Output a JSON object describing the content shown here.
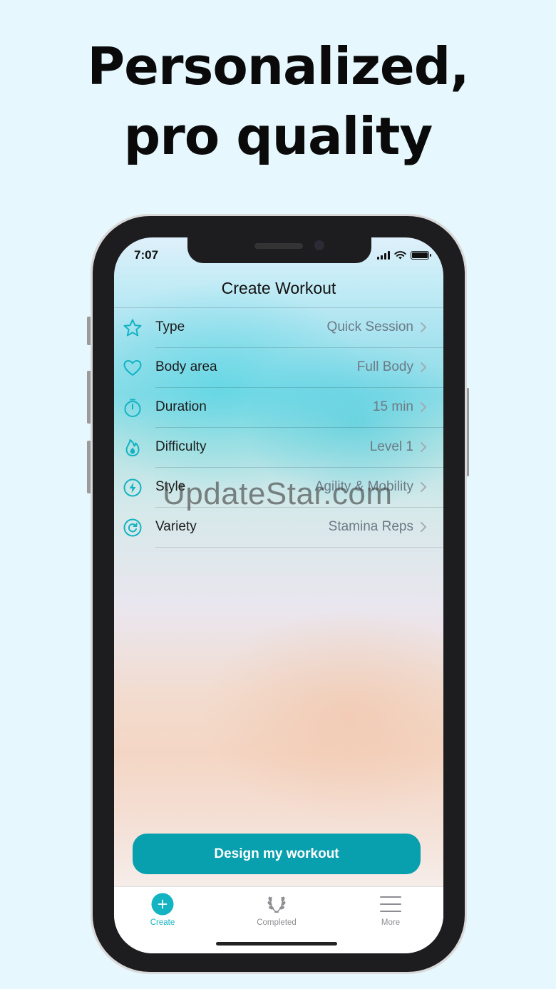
{
  "headline": {
    "line1": "Personalized,",
    "line2": "pro quality"
  },
  "watermark": "UpdateStar.com",
  "status_bar": {
    "time": "7:07"
  },
  "nav": {
    "title": "Create Workout"
  },
  "settings": [
    {
      "label": "Type",
      "value": "Quick Session",
      "icon": "star-icon"
    },
    {
      "label": "Body area",
      "value": "Full Body",
      "icon": "heart-icon"
    },
    {
      "label": "Duration",
      "value": "15 min",
      "icon": "stopwatch-icon"
    },
    {
      "label": "Difficulty",
      "value": "Level 1",
      "icon": "flame-icon"
    },
    {
      "label": "Style",
      "value": "Agility & Mobility",
      "icon": "bolt-icon"
    },
    {
      "label": "Variety",
      "value": "Stamina Reps",
      "icon": "refresh-icon"
    }
  ],
  "design_button": {
    "label": "Design my workout"
  },
  "tabs": [
    {
      "label": "Create",
      "icon": "plus-circle-icon",
      "active": true
    },
    {
      "label": "Completed",
      "icon": "laurel-icon",
      "active": false
    },
    {
      "label": "More",
      "icon": "menu-icon",
      "active": false
    }
  ],
  "colors": {
    "accent": "#089fae",
    "icon_teal": "#14b3c2",
    "value_gray": "#6c7a85",
    "tab_inactive": "#8e8e93",
    "background": "#e6f7fd"
  }
}
